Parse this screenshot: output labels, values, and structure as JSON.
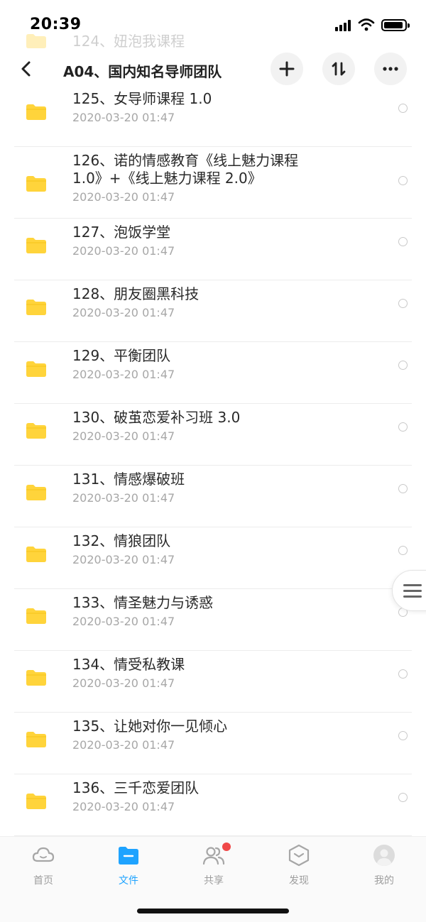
{
  "status_bar": {
    "time": "20:39"
  },
  "header": {
    "previous_item": "124、妞泡我课程",
    "title": "A04、国内知名导师团队"
  },
  "files": [
    {
      "name": "125、女导师课程 1.0",
      "date": "2020-03-20 01:47"
    },
    {
      "name": "126、诺的情感教育《线上魅力课程 1.0》+《线上魅力课程 2.0》",
      "date": "2020-03-20 01:47"
    },
    {
      "name": "127、泡饭学堂",
      "date": "2020-03-20 01:47"
    },
    {
      "name": "128、朋友圈黑科技",
      "date": "2020-03-20 01:47"
    },
    {
      "name": "129、平衡团队",
      "date": "2020-03-20 01:47"
    },
    {
      "name": "130、破茧恋爱补习班 3.0",
      "date": "2020-03-20 01:47"
    },
    {
      "name": "131、情感爆破班",
      "date": "2020-03-20 01:47"
    },
    {
      "name": "132、情狼团队",
      "date": "2020-03-20 01:47"
    },
    {
      "name": "133、情圣魅力与诱惑",
      "date": "2020-03-20 01:47"
    },
    {
      "name": "134、情受私教课",
      "date": "2020-03-20 01:47"
    },
    {
      "name": "135、让她对你一见倾心",
      "date": "2020-03-20 01:47"
    },
    {
      "name": "136、三千恋爱团队",
      "date": "2020-03-20 01:47"
    }
  ],
  "tabs": [
    {
      "label": "首页",
      "icon": "cloud-icon"
    },
    {
      "label": "文件",
      "icon": "folder-icon"
    },
    {
      "label": "共享",
      "icon": "people-icon"
    },
    {
      "label": "发现",
      "icon": "discover-icon"
    },
    {
      "label": "我的",
      "icon": "avatar-icon"
    }
  ],
  "colors": {
    "accent": "#1ea3ff",
    "folder": "#ffd43b",
    "badge": "#f04848"
  }
}
